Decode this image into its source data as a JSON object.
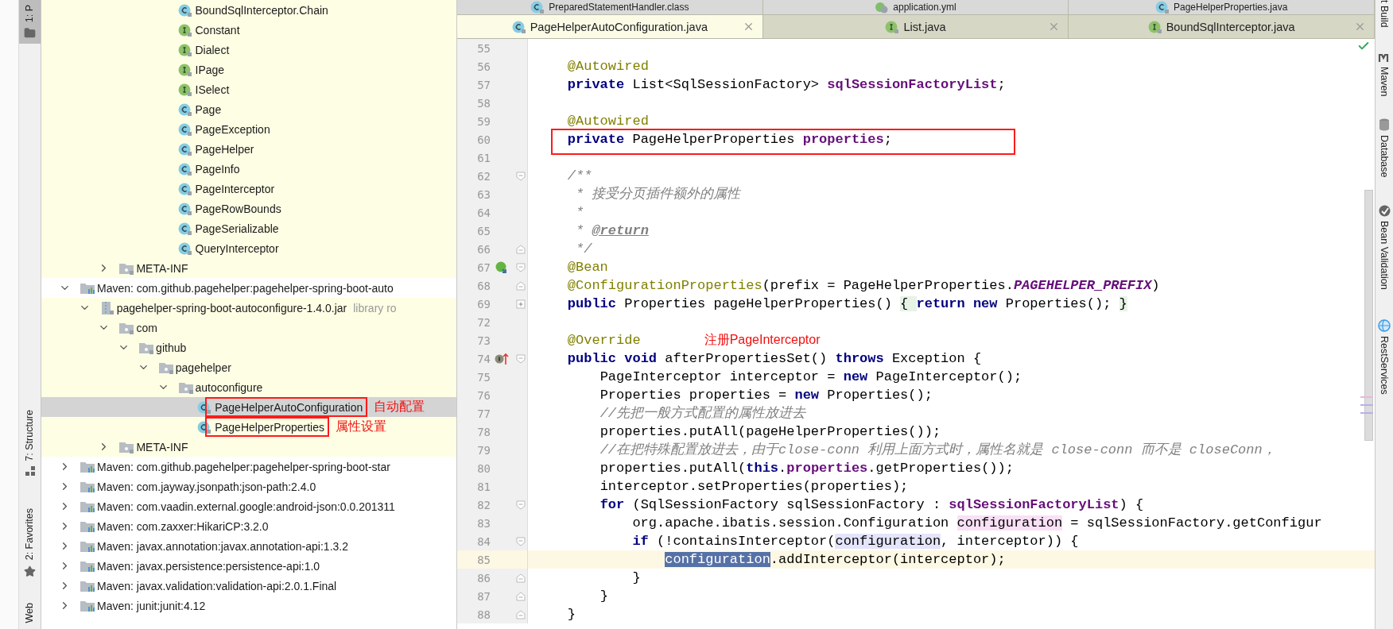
{
  "left_toolbar": [
    {
      "label": "1: P",
      "selected": true,
      "kind": "project"
    },
    {
      "label": "7: Structure",
      "selected": false,
      "kind": "structure"
    },
    {
      "label": "2: Favorites",
      "selected": false,
      "kind": "favorites"
    },
    {
      "label": "Web",
      "selected": false,
      "kind": "web"
    }
  ],
  "tree": {
    "items": [
      {
        "children": [
          {
            "children": [
              {
                "children": [
                  {
                    "children": [
                      {
                        "children": [
                          {
                            "label": "BoundSqlInterceptor.Chain",
                            "kind": "class",
                            "selected": false
                          },
                          {
                            "label": "Constant",
                            "kind": "interface",
                            "selected": false
                          },
                          {
                            "label": "Dialect",
                            "kind": "interface",
                            "selected": false
                          },
                          {
                            "label": "IPage",
                            "kind": "interface",
                            "selected": false
                          },
                          {
                            "label": "ISelect",
                            "kind": "interface",
                            "selected": false
                          },
                          {
                            "label": "Page",
                            "kind": "class",
                            "selected": false
                          },
                          {
                            "label": "PageException",
                            "kind": "class",
                            "selected": false
                          },
                          {
                            "label": "PageHelper",
                            "kind": "class",
                            "selected": false
                          },
                          {
                            "label": "PageInfo",
                            "kind": "class",
                            "selected": false
                          },
                          {
                            "label": "PageInterceptor",
                            "kind": "class",
                            "selected": false
                          },
                          {
                            "label": "PageRowBounds",
                            "kind": "class",
                            "selected": false
                          },
                          {
                            "label": "PageSerializable",
                            "kind": "class",
                            "selected": false
                          },
                          {
                            "label": "QueryInterceptor",
                            "kind": "class",
                            "selected": false
                          }
                        ]
                      }
                    ]
                  }
                ]
              },
              {
                "label": "META-INF",
                "kind": "folder",
                "expanded": false,
                "selected": false
              }
            ]
          }
        ]
      },
      {
        "label": "Maven: com.github.pagehelper:pagehelper-spring-boot-auto",
        "kind": "library",
        "expanded": true,
        "selected": false,
        "children": [
          {
            "label": "pagehelper-spring-boot-autoconfigure-1.4.0.jar",
            "suffix": "library ro",
            "kind": "jar",
            "expanded": true,
            "selected": false,
            "children": [
              {
                "label": "com",
                "kind": "folder",
                "expanded": true,
                "selected": false,
                "children": [
                  {
                    "label": "github",
                    "kind": "folder",
                    "expanded": true,
                    "selected": false,
                    "children": [
                      {
                        "label": "pagehelper",
                        "kind": "folder",
                        "expanded": true,
                        "selected": false,
                        "children": [
                          {
                            "label": "autoconfigure",
                            "kind": "folder",
                            "expanded": true,
                            "selected": false,
                            "children": [
                              {
                                "label": "PageHelperAutoConfiguration",
                                "kind": "class",
                                "selected": true,
                                "framed": true,
                                "note": "自动配置"
                              },
                              {
                                "label": "PageHelperProperties",
                                "kind": "class",
                                "selected": false,
                                "framed": true,
                                "note": "属性设置"
                              }
                            ]
                          }
                        ]
                      }
                    ]
                  }
                ]
              },
              {
                "label": "META-INF",
                "kind": "folder",
                "expanded": false,
                "selected": false
              }
            ]
          }
        ]
      },
      {
        "label": "Maven: com.github.pagehelper:pagehelper-spring-boot-star",
        "kind": "library",
        "expanded": false,
        "selected": false
      },
      {
        "label": "Maven: com.jayway.jsonpath:json-path:2.4.0",
        "kind": "library",
        "expanded": false,
        "selected": false
      },
      {
        "label": "Maven: com.vaadin.external.google:android-json:0.0.201311",
        "kind": "library",
        "expanded": false,
        "selected": false
      },
      {
        "label": "Maven: com.zaxxer:HikariCP:3.2.0",
        "kind": "library",
        "expanded": false,
        "selected": false
      },
      {
        "label": "Maven: javax.annotation:javax.annotation-api:1.3.2",
        "kind": "library",
        "expanded": false,
        "selected": false
      },
      {
        "label": "Maven: javax.persistence:persistence-api:1.0",
        "kind": "library",
        "expanded": false,
        "selected": false
      },
      {
        "label": "Maven: javax.validation:validation-api:2.0.1.Final",
        "kind": "library",
        "expanded": false,
        "selected": false
      },
      {
        "label": "Maven: junit:junit:4.12",
        "kind": "library",
        "expanded": false,
        "selected": false
      }
    ]
  },
  "editor": {
    "tab_rows": [
      {
        "tabs": [
          {
            "label": "PreparedStatementHandler.class",
            "kind": "class",
            "selected": false
          },
          {
            "label": "application.yml",
            "kind": "yaml",
            "selected": false
          },
          {
            "label": "PageHelperProperties.java",
            "kind": "class",
            "selected": false
          }
        ]
      },
      {
        "tabs": [
          {
            "label": "PageHelperAutoConfiguration.java",
            "kind": "class",
            "selected": true
          },
          {
            "label": "List.java",
            "kind": "interface",
            "selected": false
          },
          {
            "label": "BoundSqlInterceptor.java",
            "kind": "interface",
            "selected": false
          }
        ]
      }
    ],
    "lines": [
      {
        "number": "55",
        "current": false
      },
      {
        "number": "56",
        "current": false,
        "tokens": [
          {
            "text": "    @Autowired",
            "kind": "annotation"
          }
        ]
      },
      {
        "number": "57",
        "current": false,
        "tokens": [
          {
            "text": "    private",
            "kind": "keyword"
          },
          {
            "text": " List<SqlSessionFactory> ",
            "kind": "plain"
          },
          {
            "text": "sqlSessionFactoryList",
            "kind": "field"
          },
          {
            "text": ";",
            "kind": "plain"
          }
        ]
      },
      {
        "number": "58",
        "current": false
      },
      {
        "number": "59",
        "current": false,
        "tokens": [
          {
            "text": "    @Autowired",
            "kind": "annotation"
          }
        ]
      },
      {
        "number": "60",
        "current": false,
        "framed": true,
        "tokens": [
          {
            "text": "    private",
            "kind": "keyword"
          },
          {
            "text": " PageHelperProperties ",
            "kind": "plain"
          },
          {
            "text": "properties",
            "kind": "field"
          },
          {
            "text": ";",
            "kind": "plain"
          }
        ]
      },
      {
        "number": "61",
        "current": false
      },
      {
        "number": "62",
        "current": false,
        "gutter": [
          {
            "kind": "fold-start"
          }
        ],
        "tokens": [
          {
            "text": "    /**",
            "kind": "doc"
          }
        ]
      },
      {
        "number": "63",
        "current": false,
        "tokens": [
          {
            "text": "     * 接受分页插件额外的属性",
            "kind": "doc"
          }
        ]
      },
      {
        "number": "64",
        "current": false,
        "tokens": [
          {
            "text": "     *",
            "kind": "doc"
          }
        ]
      },
      {
        "number": "65",
        "current": false,
        "tokens": [
          {
            "text": "     * ",
            "kind": "doc"
          },
          {
            "text": "@return",
            "kind": "doctag"
          }
        ]
      },
      {
        "number": "66",
        "current": false,
        "gutter": [
          {
            "kind": "fold-end"
          }
        ],
        "tokens": [
          {
            "text": "     */",
            "kind": "doc"
          }
        ]
      },
      {
        "number": "67",
        "current": false,
        "gutter": [
          {
            "kind": "bean"
          },
          {
            "kind": "fold-start"
          }
        ],
        "tokens": [
          {
            "text": "    @Bean",
            "kind": "annotation"
          }
        ]
      },
      {
        "number": "68",
        "current": false,
        "gutter": [
          {
            "kind": "fold-end"
          }
        ],
        "tokens": [
          {
            "text": "    @ConfigurationProperties",
            "kind": "annotation"
          },
          {
            "text": "(prefix = PageHelperProperties.",
            "kind": "plain"
          },
          {
            "text": "PAGEHELPER_PREFIX",
            "kind": "constant"
          },
          {
            "text": ")",
            "kind": "plain"
          }
        ]
      },
      {
        "number": "69",
        "current": false,
        "gutter": [
          {
            "kind": "fold-collapsed"
          }
        ],
        "tokens": [
          {
            "text": "    public",
            "kind": "keyword"
          },
          {
            "text": " Properties pageHelperProperties() ",
            "kind": "plain"
          },
          {
            "text": "{ ",
            "kind": "folded"
          },
          {
            "text": "return new",
            "kind": "keyword"
          },
          {
            "text": " Properties(); ",
            "kind": "plain"
          },
          {
            "text": "}",
            "kind": "folded"
          }
        ]
      },
      {
        "number": "72",
        "current": false
      },
      {
        "number": "73",
        "current": false,
        "note": "注册PageInterceptor",
        "tokens": [
          {
            "text": "    @Override",
            "kind": "annotation"
          }
        ]
      },
      {
        "number": "74",
        "current": false,
        "gutter": [
          {
            "kind": "override"
          },
          {
            "kind": "fold-start"
          }
        ],
        "tokens": [
          {
            "text": "    public void",
            "kind": "keyword"
          },
          {
            "text": " afterPropertiesSet() ",
            "kind": "plain"
          },
          {
            "text": "throws",
            "kind": "keyword"
          },
          {
            "text": " Exception {",
            "kind": "plain"
          }
        ]
      },
      {
        "number": "75",
        "current": false,
        "tokens": [
          {
            "text": "        PageInterceptor interceptor = ",
            "kind": "plain"
          },
          {
            "text": "new",
            "kind": "keyword"
          },
          {
            "text": " PageInterceptor();",
            "kind": "plain"
          }
        ]
      },
      {
        "number": "76",
        "current": false,
        "tokens": [
          {
            "text": "        Properties properties = ",
            "kind": "plain"
          },
          {
            "text": "new",
            "kind": "keyword"
          },
          {
            "text": " Properties();",
            "kind": "plain"
          }
        ]
      },
      {
        "number": "77",
        "current": false,
        "tokens": [
          {
            "text": "        //先把一般方式配置的属性放进去",
            "kind": "comment"
          }
        ]
      },
      {
        "number": "78",
        "current": false,
        "tokens": [
          {
            "text": "        properties.putAll(pageHelperProperties());",
            "kind": "plain"
          }
        ]
      },
      {
        "number": "79",
        "current": false,
        "tokens": [
          {
            "text": "        //在把特殊配置放进去，由于close-conn 利用上面方式时，属性名就是 close-conn 而不是 closeConn，",
            "kind": "comment"
          }
        ]
      },
      {
        "number": "80",
        "current": false,
        "tokens": [
          {
            "text": "        properties.putAll(",
            "kind": "plain"
          },
          {
            "text": "this",
            "kind": "keyword"
          },
          {
            "text": ".",
            "kind": "plain"
          },
          {
            "text": "properties",
            "kind": "field"
          },
          {
            "text": ".getProperties());",
            "kind": "plain"
          }
        ]
      },
      {
        "number": "81",
        "current": false,
        "tokens": [
          {
            "text": "        interceptor.setProperties(properties);",
            "kind": "plain"
          }
        ]
      },
      {
        "number": "82",
        "current": false,
        "gutter": [
          {
            "kind": "fold-start"
          }
        ],
        "tokens": [
          {
            "text": "        for",
            "kind": "keyword"
          },
          {
            "text": " (SqlSessionFactory sqlSessionFactory : ",
            "kind": "plain"
          },
          {
            "text": "sqlSessionFactoryList",
            "kind": "field"
          },
          {
            "text": ") {",
            "kind": "plain"
          }
        ]
      },
      {
        "number": "83",
        "current": false,
        "tokens": [
          {
            "text": "            org.apache.ibatis.session.Configuration ",
            "kind": "plain"
          },
          {
            "text": "configuration",
            "kind": "write-usage"
          },
          {
            "text": " = sqlSessionFactory.getConfigur",
            "kind": "plain"
          }
        ]
      },
      {
        "number": "84",
        "current": false,
        "gutter": [
          {
            "kind": "fold-start"
          }
        ],
        "tokens": [
          {
            "text": "            if",
            "kind": "keyword"
          },
          {
            "text": " (!containsInterceptor(",
            "kind": "plain"
          },
          {
            "text": "configuration",
            "kind": "read-usage"
          },
          {
            "text": ", interceptor)) {",
            "kind": "plain"
          }
        ]
      },
      {
        "number": "85",
        "current": true,
        "tokens": [
          {
            "text": "                configuration",
            "kind": "selection"
          },
          {
            "text": ".addInterceptor(interceptor);",
            "kind": "plain"
          }
        ]
      },
      {
        "number": "86",
        "current": false,
        "gutter": [
          {
            "kind": "fold-end"
          }
        ],
        "tokens": [
          {
            "text": "            }",
            "kind": "plain"
          }
        ]
      },
      {
        "number": "87",
        "current": false,
        "gutter": [
          {
            "kind": "fold-end"
          }
        ],
        "tokens": [
          {
            "text": "        }",
            "kind": "plain"
          }
        ]
      },
      {
        "number": "88",
        "current": false,
        "gutter": [
          {
            "kind": "fold-end"
          }
        ],
        "tokens": [
          {
            "text": "    }",
            "kind": "plain"
          }
        ]
      }
    ]
  },
  "right_toolbar": [
    {
      "label": "t Build",
      "kind": "build"
    },
    {
      "label": "Maven",
      "kind": "maven"
    },
    {
      "label": "Database",
      "kind": "database"
    },
    {
      "label": "Bean Validation",
      "kind": "bean"
    },
    {
      "label": "RestServices",
      "kind": "rest"
    }
  ]
}
